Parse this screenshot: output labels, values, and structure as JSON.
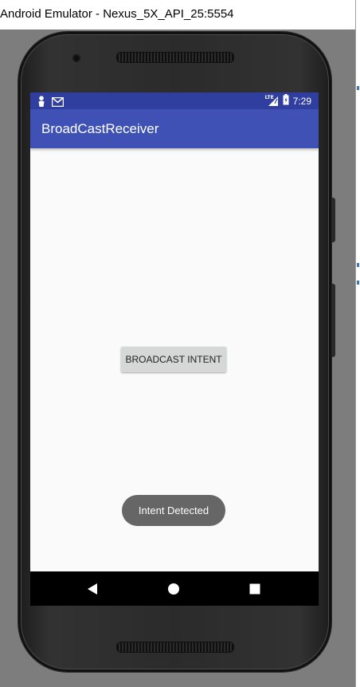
{
  "window": {
    "title": "Android Emulator - Nexus_5X_API_25:5554"
  },
  "status_bar": {
    "time": "7:29",
    "network_label": "LTE",
    "left_icons": [
      "notification-person-icon",
      "gmail-icon"
    ],
    "right_icons": [
      "lte-signal-icon",
      "battery-icon"
    ],
    "color": "#303f9f"
  },
  "app_bar": {
    "title": "BroadCastReceiver",
    "color": "#3f51b5"
  },
  "main": {
    "broadcast_button_label": "BROADCAST INTENT"
  },
  "toast": {
    "message": "Intent Detected"
  },
  "nav_bar": {
    "buttons": [
      "back-icon",
      "home-icon",
      "recents-icon"
    ]
  }
}
